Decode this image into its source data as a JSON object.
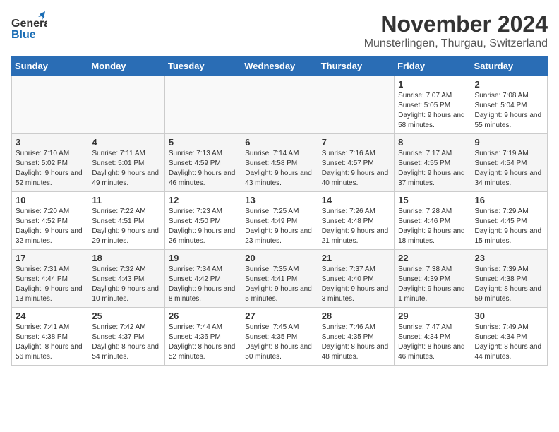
{
  "header": {
    "logo_general": "General",
    "logo_blue": "Blue",
    "title": "November 2024",
    "subtitle": "Munsterlingen, Thurgau, Switzerland"
  },
  "days_of_week": [
    "Sunday",
    "Monday",
    "Tuesday",
    "Wednesday",
    "Thursday",
    "Friday",
    "Saturday"
  ],
  "weeks": [
    [
      {
        "day": "",
        "info": ""
      },
      {
        "day": "",
        "info": ""
      },
      {
        "day": "",
        "info": ""
      },
      {
        "day": "",
        "info": ""
      },
      {
        "day": "",
        "info": ""
      },
      {
        "day": "1",
        "info": "Sunrise: 7:07 AM\nSunset: 5:05 PM\nDaylight: 9 hours and 58 minutes."
      },
      {
        "day": "2",
        "info": "Sunrise: 7:08 AM\nSunset: 5:04 PM\nDaylight: 9 hours and 55 minutes."
      }
    ],
    [
      {
        "day": "3",
        "info": "Sunrise: 7:10 AM\nSunset: 5:02 PM\nDaylight: 9 hours and 52 minutes."
      },
      {
        "day": "4",
        "info": "Sunrise: 7:11 AM\nSunset: 5:01 PM\nDaylight: 9 hours and 49 minutes."
      },
      {
        "day": "5",
        "info": "Sunrise: 7:13 AM\nSunset: 4:59 PM\nDaylight: 9 hours and 46 minutes."
      },
      {
        "day": "6",
        "info": "Sunrise: 7:14 AM\nSunset: 4:58 PM\nDaylight: 9 hours and 43 minutes."
      },
      {
        "day": "7",
        "info": "Sunrise: 7:16 AM\nSunset: 4:57 PM\nDaylight: 9 hours and 40 minutes."
      },
      {
        "day": "8",
        "info": "Sunrise: 7:17 AM\nSunset: 4:55 PM\nDaylight: 9 hours and 37 minutes."
      },
      {
        "day": "9",
        "info": "Sunrise: 7:19 AM\nSunset: 4:54 PM\nDaylight: 9 hours and 34 minutes."
      }
    ],
    [
      {
        "day": "10",
        "info": "Sunrise: 7:20 AM\nSunset: 4:52 PM\nDaylight: 9 hours and 32 minutes."
      },
      {
        "day": "11",
        "info": "Sunrise: 7:22 AM\nSunset: 4:51 PM\nDaylight: 9 hours and 29 minutes."
      },
      {
        "day": "12",
        "info": "Sunrise: 7:23 AM\nSunset: 4:50 PM\nDaylight: 9 hours and 26 minutes."
      },
      {
        "day": "13",
        "info": "Sunrise: 7:25 AM\nSunset: 4:49 PM\nDaylight: 9 hours and 23 minutes."
      },
      {
        "day": "14",
        "info": "Sunrise: 7:26 AM\nSunset: 4:48 PM\nDaylight: 9 hours and 21 minutes."
      },
      {
        "day": "15",
        "info": "Sunrise: 7:28 AM\nSunset: 4:46 PM\nDaylight: 9 hours and 18 minutes."
      },
      {
        "day": "16",
        "info": "Sunrise: 7:29 AM\nSunset: 4:45 PM\nDaylight: 9 hours and 15 minutes."
      }
    ],
    [
      {
        "day": "17",
        "info": "Sunrise: 7:31 AM\nSunset: 4:44 PM\nDaylight: 9 hours and 13 minutes."
      },
      {
        "day": "18",
        "info": "Sunrise: 7:32 AM\nSunset: 4:43 PM\nDaylight: 9 hours and 10 minutes."
      },
      {
        "day": "19",
        "info": "Sunrise: 7:34 AM\nSunset: 4:42 PM\nDaylight: 9 hours and 8 minutes."
      },
      {
        "day": "20",
        "info": "Sunrise: 7:35 AM\nSunset: 4:41 PM\nDaylight: 9 hours and 5 minutes."
      },
      {
        "day": "21",
        "info": "Sunrise: 7:37 AM\nSunset: 4:40 PM\nDaylight: 9 hours and 3 minutes."
      },
      {
        "day": "22",
        "info": "Sunrise: 7:38 AM\nSunset: 4:39 PM\nDaylight: 9 hours and 1 minute."
      },
      {
        "day": "23",
        "info": "Sunrise: 7:39 AM\nSunset: 4:38 PM\nDaylight: 8 hours and 59 minutes."
      }
    ],
    [
      {
        "day": "24",
        "info": "Sunrise: 7:41 AM\nSunset: 4:38 PM\nDaylight: 8 hours and 56 minutes."
      },
      {
        "day": "25",
        "info": "Sunrise: 7:42 AM\nSunset: 4:37 PM\nDaylight: 8 hours and 54 minutes."
      },
      {
        "day": "26",
        "info": "Sunrise: 7:44 AM\nSunset: 4:36 PM\nDaylight: 8 hours and 52 minutes."
      },
      {
        "day": "27",
        "info": "Sunrise: 7:45 AM\nSunset: 4:35 PM\nDaylight: 8 hours and 50 minutes."
      },
      {
        "day": "28",
        "info": "Sunrise: 7:46 AM\nSunset: 4:35 PM\nDaylight: 8 hours and 48 minutes."
      },
      {
        "day": "29",
        "info": "Sunrise: 7:47 AM\nSunset: 4:34 PM\nDaylight: 8 hours and 46 minutes."
      },
      {
        "day": "30",
        "info": "Sunrise: 7:49 AM\nSunset: 4:34 PM\nDaylight: 8 hours and 44 minutes."
      }
    ]
  ]
}
